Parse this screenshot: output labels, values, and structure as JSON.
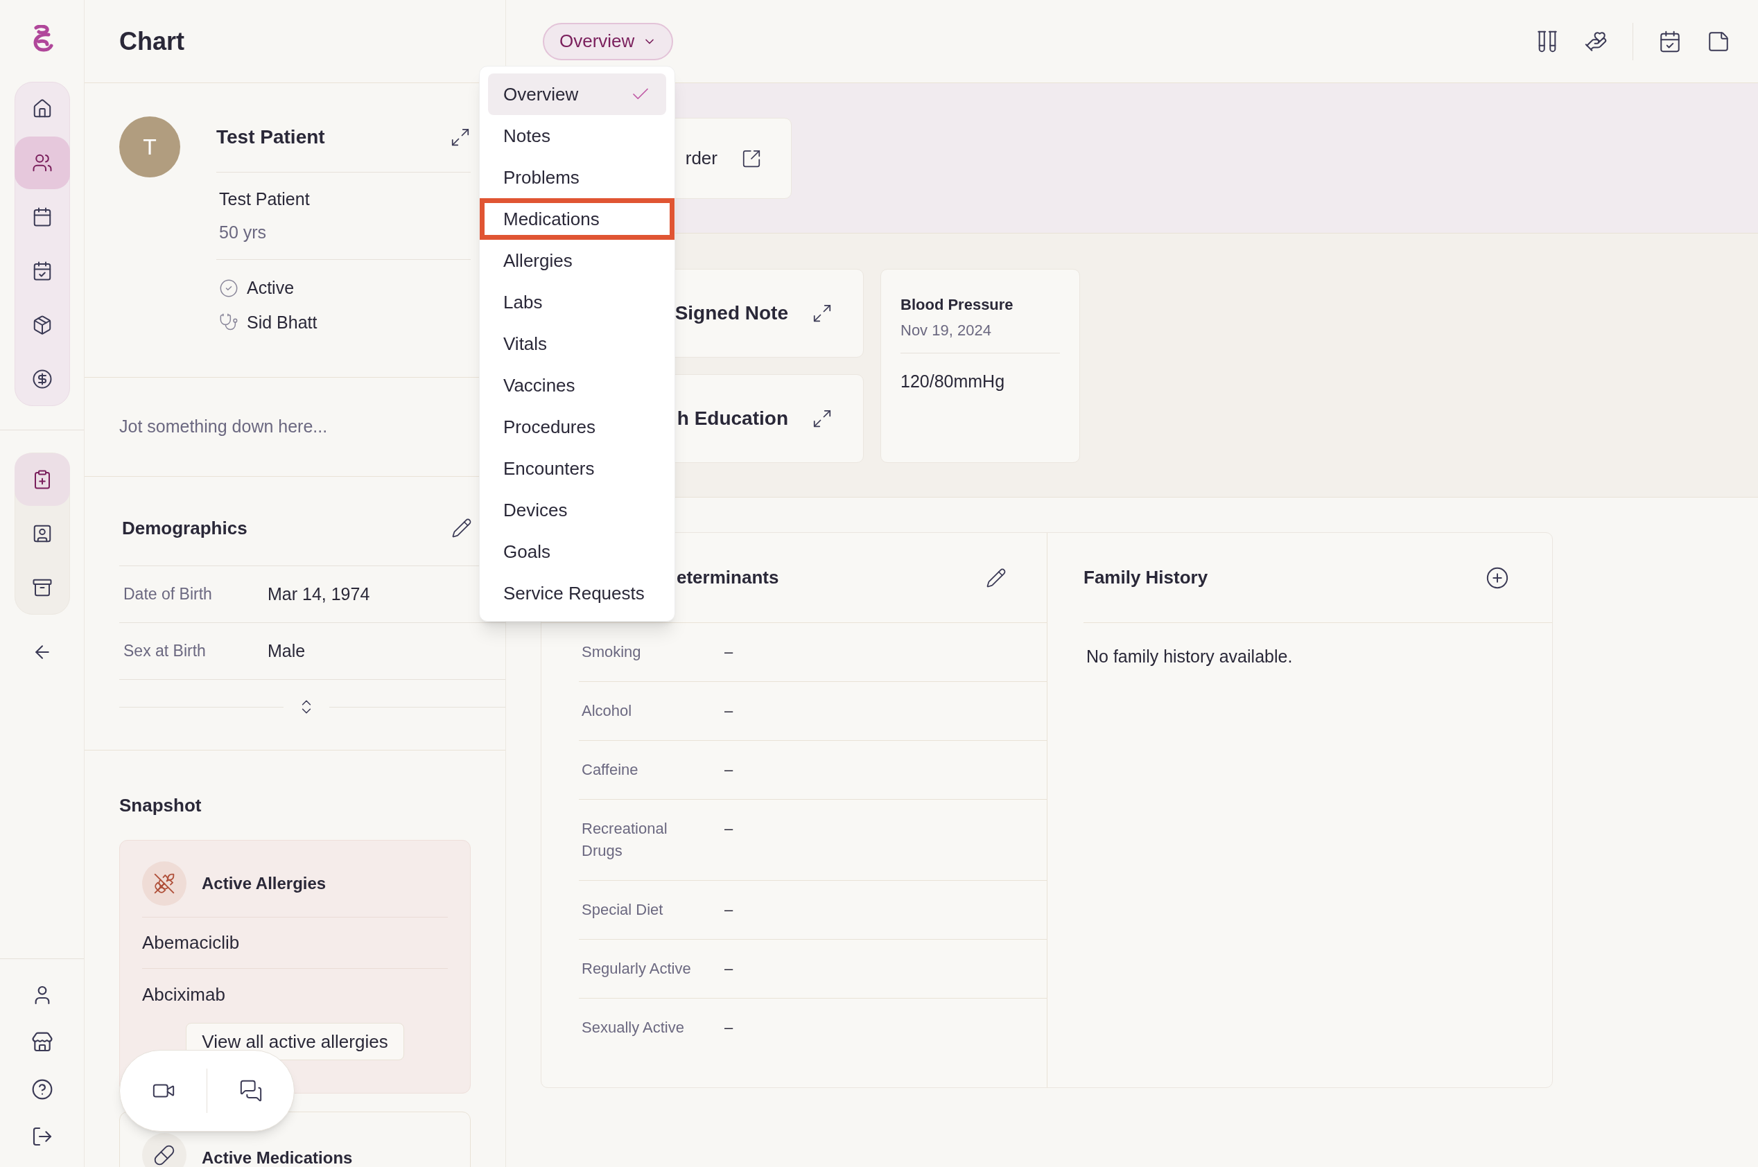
{
  "sidebar": {
    "top_group": [
      {
        "selected": false
      },
      {
        "selected": true
      },
      {
        "selected": false
      },
      {
        "selected": false
      },
      {
        "selected": false
      },
      {
        "selected": false
      }
    ],
    "second_group": [
      {
        "selected": true
      },
      {
        "selected": false
      },
      {
        "selected": false
      }
    ]
  },
  "left_panel": {
    "title": "Chart",
    "patient": {
      "initial": "T",
      "name": "Test Patient",
      "full_name": "Test Patient",
      "age": "50 yrs",
      "status": "Active",
      "provider": "Sid Bhatt"
    },
    "note": {
      "placeholder": "Jot something down here..."
    },
    "demographics": {
      "title": "Demographics",
      "rows": [
        {
          "label": "Date of Birth",
          "value": "Mar 14, 1974"
        },
        {
          "label": "Sex at Birth",
          "value": "Male"
        }
      ]
    },
    "snapshot": {
      "title": "Snapshot",
      "allergies": {
        "title": "Active Allergies",
        "items": [
          "Abemaciclib",
          "Abciximab"
        ],
        "button": "View all active allergies"
      },
      "medications": {
        "title": "Active Medications"
      }
    }
  },
  "header": {
    "view_button": "Overview"
  },
  "view_menu": [
    {
      "label": "Overview",
      "selected": true,
      "highlighted": false
    },
    {
      "label": "Notes",
      "selected": false,
      "highlighted": false
    },
    {
      "label": "Problems",
      "selected": false,
      "highlighted": false
    },
    {
      "label": "Medications",
      "selected": false,
      "highlighted": true
    },
    {
      "label": "Allergies",
      "selected": false,
      "highlighted": false
    },
    {
      "label": "Labs",
      "selected": false,
      "highlighted": false
    },
    {
      "label": "Vitals",
      "selected": false,
      "highlighted": false
    },
    {
      "label": "Vaccines",
      "selected": false,
      "highlighted": false
    },
    {
      "label": "Procedures",
      "selected": false,
      "highlighted": false
    },
    {
      "label": "Encounters",
      "selected": false,
      "highlighted": false
    },
    {
      "label": "Devices",
      "selected": false,
      "highlighted": false
    },
    {
      "label": "Goals",
      "selected": false,
      "highlighted": false
    },
    {
      "label": "Service Requests",
      "selected": false,
      "highlighted": false
    }
  ],
  "banner_card": {
    "text": "rder"
  },
  "summary_cards": [
    {
      "title": "Signed Note"
    },
    {
      "title": "h Education"
    }
  ],
  "vital_card": {
    "title": "Blood Pressure",
    "date": "Nov 19, 2024",
    "value": "120/80mmHg"
  },
  "social_card": {
    "title": "eterminants",
    "rows": [
      {
        "label": "Smoking",
        "value": "–"
      },
      {
        "label": "Alcohol",
        "value": "–"
      },
      {
        "label": "Caffeine",
        "value": "–"
      },
      {
        "label": "Recreational Drugs",
        "value": "–"
      },
      {
        "label": "Special Diet",
        "value": "–"
      },
      {
        "label": "Regularly Active",
        "value": "–"
      },
      {
        "label": "Sexually Active",
        "value": "–"
      }
    ]
  },
  "family_history": {
    "title": "Family History",
    "empty_text": "No family history available."
  }
}
